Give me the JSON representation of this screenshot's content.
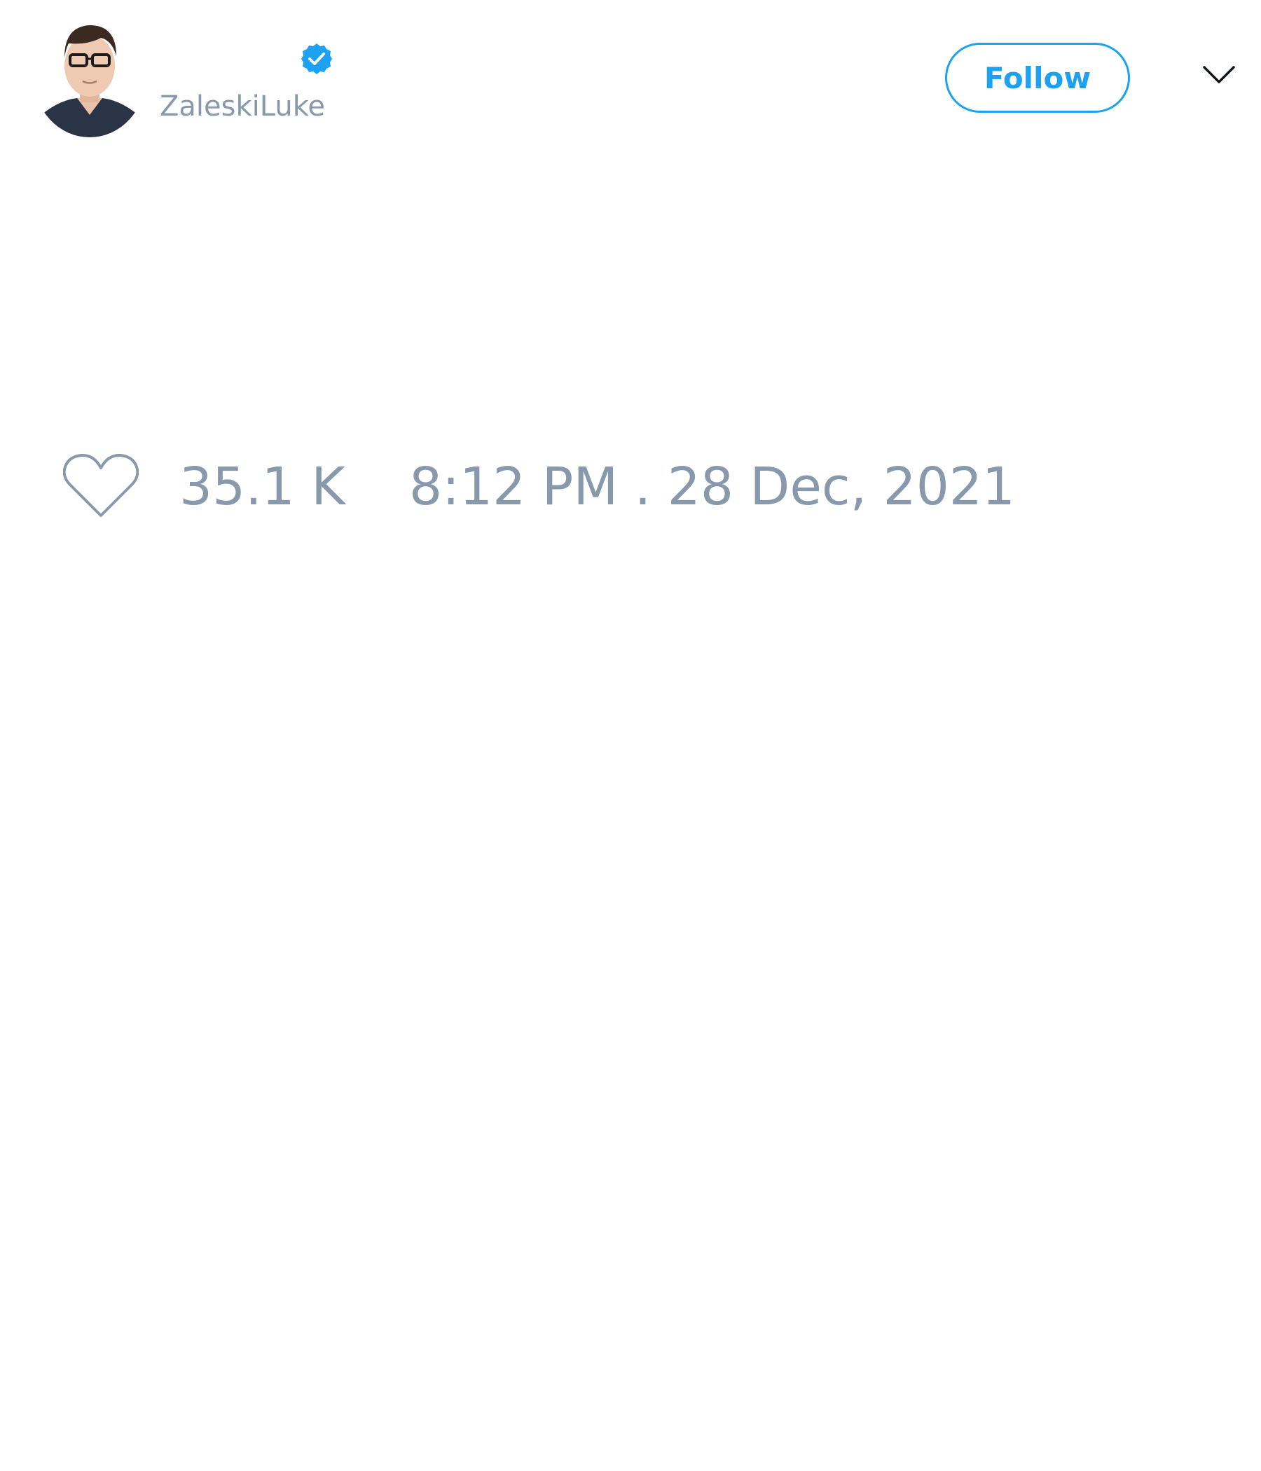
{
  "tweet": {
    "author": {
      "display_name": "",
      "handle": "ZaleskiLuke",
      "verified": true,
      "avatar_icon": "avatar-portrait"
    },
    "actions": {
      "follow_label": "Follow",
      "menu_icon": "chevron-down-icon"
    },
    "stats": {
      "like_icon": "heart-outline-icon",
      "like_count": "35.1 K",
      "timestamp": "8:12 PM . 28 Dec, 2021"
    }
  },
  "colors": {
    "accent": "#1da1f2",
    "muted_text": "#8899ac",
    "background": "#ffffff"
  }
}
